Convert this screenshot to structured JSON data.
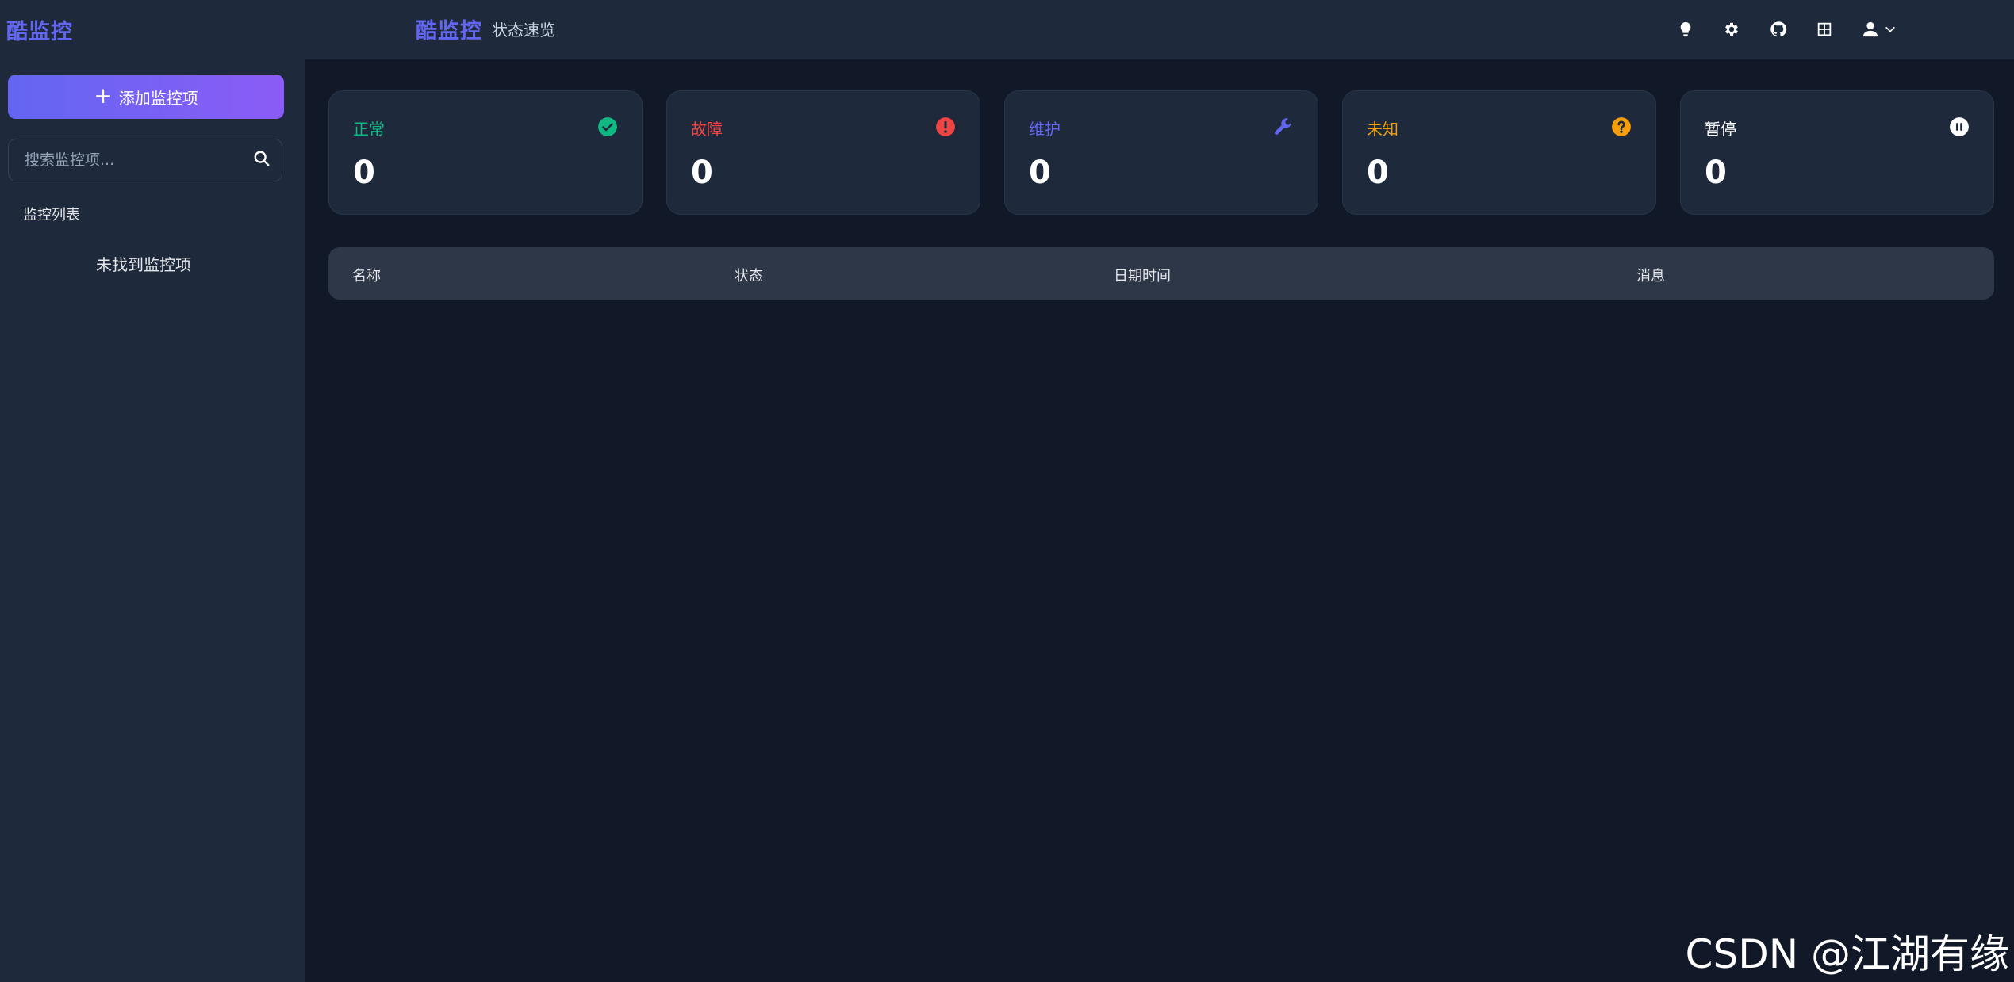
{
  "sidebar": {
    "logo": "酷监控",
    "add_button_label": "添加监控项",
    "search_placeholder": "搜索监控项...",
    "list_title": "监控列表",
    "empty_text": "未找到监控项"
  },
  "header": {
    "brand": "酷监控",
    "nav_link": "状态速览",
    "icons": [
      "lightbulb-icon",
      "gear-icon",
      "github-icon",
      "grid-icon",
      "user-icon",
      "chevron-down-icon"
    ]
  },
  "stats": [
    {
      "label": "正常",
      "value": "0",
      "color": "#10b981",
      "icon": "check-circle-icon"
    },
    {
      "label": "故障",
      "value": "0",
      "color": "#ef4444",
      "icon": "alert-circle-icon"
    },
    {
      "label": "维护",
      "value": "0",
      "color": "#6366f1",
      "icon": "wrench-icon"
    },
    {
      "label": "未知",
      "value": "0",
      "color": "#f59e0b",
      "icon": "question-circle-icon"
    },
    {
      "label": "暂停",
      "value": "0",
      "color": "#ffffff",
      "icon": "pause-circle-icon"
    }
  ],
  "table": {
    "columns": [
      "名称",
      "状态",
      "日期时间",
      "消息"
    ]
  },
  "watermark": "CSDN @江湖有缘"
}
